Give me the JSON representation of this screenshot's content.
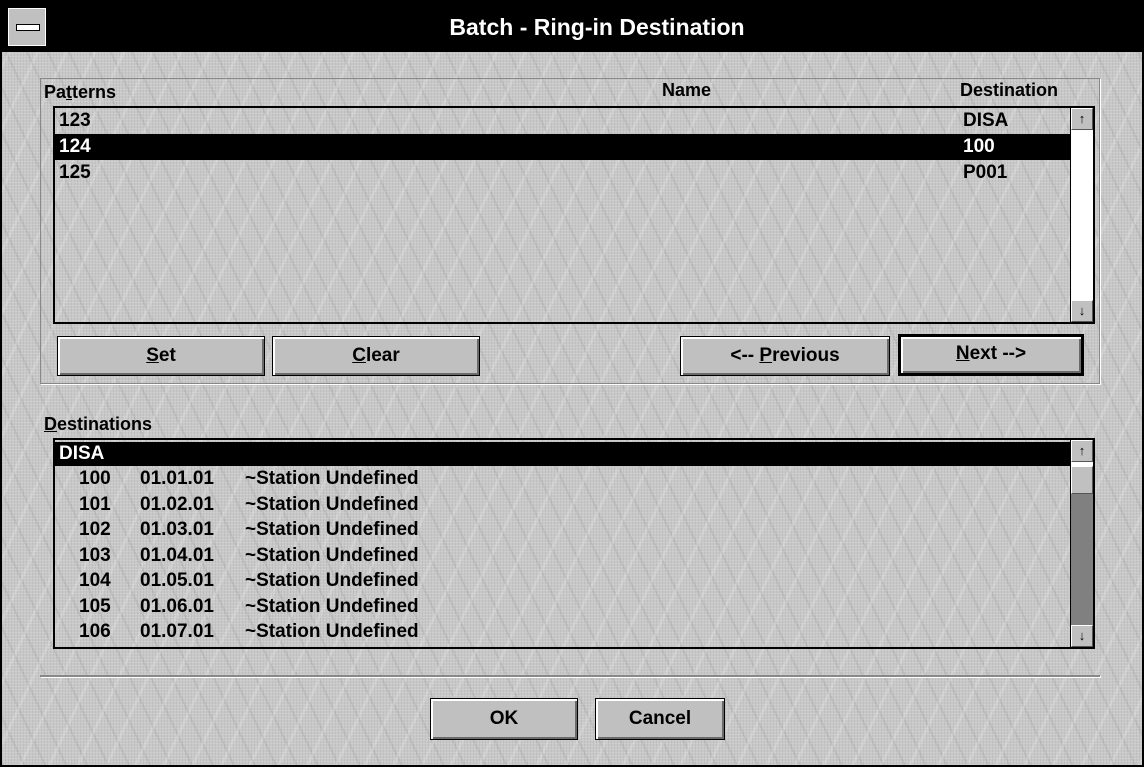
{
  "window": {
    "title": "Batch - Ring-in Destination"
  },
  "patterns_panel": {
    "label": "Patterns",
    "name_header": "Name",
    "destination_header": "Destination",
    "rows": [
      {
        "pattern": "123",
        "name": "",
        "destination": "DISA",
        "selected": false
      },
      {
        "pattern": "124",
        "name": "",
        "destination": "100",
        "selected": true
      },
      {
        "pattern": "125",
        "name": "",
        "destination": "P001",
        "selected": false
      }
    ],
    "scroll_up_glyph": "↑",
    "scroll_down_glyph": "↓"
  },
  "buttons": {
    "set": "Set",
    "clear": "Clear",
    "previous": "<-- Previous",
    "next": "Next -->",
    "ok": "OK",
    "cancel": "Cancel"
  },
  "destinations_panel": {
    "label": "Destinations",
    "header_row": "DISA",
    "rows": [
      {
        "number": "100",
        "port": "01.01.01",
        "name": "~Station Undefined"
      },
      {
        "number": "101",
        "port": "01.02.01",
        "name": "~Station Undefined"
      },
      {
        "number": "102",
        "port": "01.03.01",
        "name": "~Station Undefined"
      },
      {
        "number": "103",
        "port": "01.04.01",
        "name": "~Station Undefined"
      },
      {
        "number": "104",
        "port": "01.05.01",
        "name": "~Station Undefined"
      },
      {
        "number": "105",
        "port": "01.06.01",
        "name": "~Station Undefined"
      },
      {
        "number": "106",
        "port": "01.07.01",
        "name": "~Station Undefined"
      }
    ]
  },
  "colors": {
    "title_bg": "#000000",
    "selection_bg": "#000000",
    "face": "#c0c0c0"
  }
}
